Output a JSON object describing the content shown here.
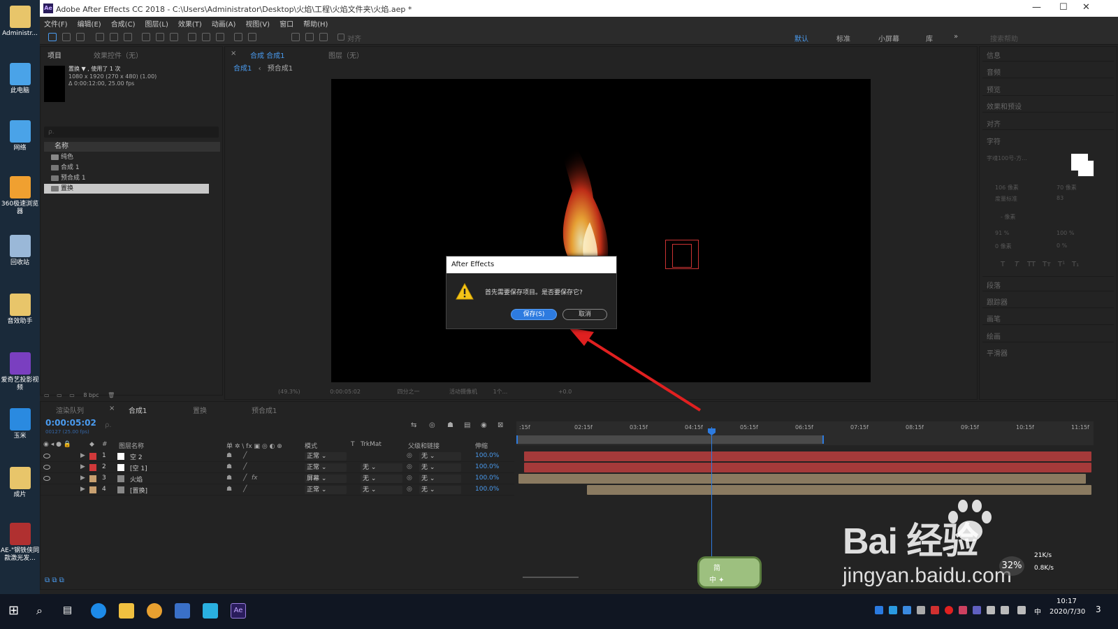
{
  "window": {
    "title": "Adobe After Effects CC 2018 - C:\\Users\\Administrator\\Desktop\\火焰\\工程\\火焰文件夹\\火焰.aep *",
    "logo": "Ae",
    "controls": [
      "—",
      "☐",
      "✕"
    ]
  },
  "desktop_icons": [
    {
      "label": "Administr...",
      "icon": "user-folder-icon",
      "color": "#e8c56a"
    },
    {
      "label": "此电脑",
      "icon": "computer-icon",
      "color": "#4aa3e8"
    },
    {
      "label": "网络",
      "icon": "network-icon",
      "color": "#4aa3e8"
    },
    {
      "label": "360极速浏览器",
      "icon": "browser-360-icon",
      "color": "#f0a030"
    },
    {
      "label": "回收站",
      "icon": "recycle-bin-icon",
      "color": "#9ab8d8"
    },
    {
      "label": "音效助手",
      "icon": "audio-helper-icon",
      "color": "#e8c56a"
    },
    {
      "label": "爱奇艺投影视频",
      "icon": "iqiyi-icon",
      "color": "#7a3fc0"
    },
    {
      "label": "玉米",
      "icon": "mp3-file-icon",
      "color": "#2a8ae0"
    },
    {
      "label": "成片",
      "icon": "folder-icon",
      "color": "#e8c56a"
    },
    {
      "label": "AE-\"钢铁侠同款激光发...",
      "icon": "rar-archive-icon",
      "color": "#b03030"
    }
  ],
  "menu": [
    "文件(F)",
    "编辑(E)",
    "合成(C)",
    "图层(L)",
    "效果(T)",
    "动画(A)",
    "视图(V)",
    "窗口",
    "帮助(H)"
  ],
  "toolbar": {
    "snap_label": "对齐",
    "workspaces": [
      "默认",
      "标准",
      "小屏幕",
      "库"
    ],
    "active_workspace": "默认",
    "search_placeholder": "搜索帮助"
  },
  "project_panel": {
    "tabs": [
      "项目",
      "效果控件（无）"
    ],
    "item_name": "置换 ▼ , 使用了 1 次",
    "item_dims": "1080 x 1920 (270 x 480) (1.00)",
    "item_duration": "Δ 0:00:12:00, 25.00 fps",
    "search_placeholder": "ρ.",
    "column_name": "名称",
    "items": [
      "纯色",
      "合成 1",
      "预合成 1",
      "置换"
    ],
    "selected_item": "置换",
    "footer_bpc": "8 bpc"
  },
  "comp_panel": {
    "tabs": [
      "合成 合成1",
      "图层（无）"
    ],
    "breadcrumbs": [
      "合成1",
      "预合成1"
    ],
    "footer": {
      "zoom": "(49.3%)",
      "time": "0:00:05:02",
      "resolution": "四分之一",
      "camera": "活动摄像机",
      "views": "1个...",
      "exposure": "+0.0"
    }
  },
  "dialog": {
    "title": "After Effects",
    "message": "首先需要保存项目。是否要保存它?",
    "save_button": "保存(S)",
    "cancel_button": "取消",
    "icon": "warning-icon"
  },
  "right_panel": {
    "sections": [
      "信息",
      "音频",
      "预览",
      "效果和预设",
      "对齐",
      "字符",
      "段落",
      "跟踪器",
      "画笔",
      "绘画",
      "平滑器"
    ],
    "character": {
      "font": "字魂100号-方...",
      "size": "106 像素",
      "leading": "70 像素",
      "kerning": "度量标准",
      "tracking": "83",
      "stroke": "- 像素",
      "vscale": "91 %",
      "hscale": "100 %",
      "baseline": "0 像素",
      "tsume": "0 %",
      "styles": [
        "T",
        "T",
        "TT",
        "Tт",
        "T¹",
        "T₁"
      ]
    }
  },
  "timeline": {
    "tabs": [
      "渲染队列",
      "合成1",
      "置换",
      "预合成1"
    ],
    "active_tab": "合成1",
    "timecode": "0:00:05:02",
    "timecode_sub": "00127 (25.00 fps)",
    "search_placeholder": "ρ.",
    "columns": {
      "number": "#",
      "name": "图层名称",
      "switches": "单 ✲ \\ fx ▣ ◎ ◐ ⊕",
      "mode": "模式",
      "t": "T",
      "trkmat": "TrkMat",
      "parent": "父级和链接",
      "stretch": "伸缩"
    },
    "layers": [
      {
        "num": "1",
        "name": "空 2",
        "color": "#d0393a",
        "type_color": "#ffffff",
        "mode": "正常",
        "trkmat": "",
        "parent": "无",
        "stretch": "100.0%",
        "eye": true,
        "fx": false
      },
      {
        "num": "2",
        "name": "[空 1]",
        "color": "#d0393a",
        "type_color": "#ffffff",
        "mode": "正常",
        "trkmat": "无",
        "parent": "无",
        "stretch": "100.0%",
        "eye": true,
        "fx": false
      },
      {
        "num": "3",
        "name": "火焰",
        "color": "#c8a070",
        "type_color": "#888888",
        "mode": "屏幕",
        "trkmat": "无",
        "parent": "无",
        "stretch": "100.0%",
        "eye": true,
        "fx": true
      },
      {
        "num": "4",
        "name": "[置换]",
        "color": "#c8a070",
        "type_color": "#888888",
        "mode": "正常",
        "trkmat": "无",
        "parent": "无",
        "stretch": "100.0%",
        "eye": false,
        "fx": false
      }
    ],
    "ruler_ticks": [
      ":15f",
      "02:15f",
      "03:15f",
      "04:15f",
      "05:15f",
      "06:15f",
      "07:15f",
      "08:15f",
      "09:15f",
      "10:15f",
      "11:15f"
    ]
  },
  "watermark": {
    "brand": "Bai 经验",
    "url": "jingyan.baidu.com"
  },
  "ime": {
    "line1": "简",
    "line2": "中 ✦"
  },
  "speed_widget": {
    "percent": "32%",
    "up": "21K/s",
    "down": "0.8K/s"
  },
  "taskbar": {
    "clock_time": "10:17",
    "clock_date": "2020/7/30",
    "ime_indicator": "中",
    "notifications": "3"
  }
}
